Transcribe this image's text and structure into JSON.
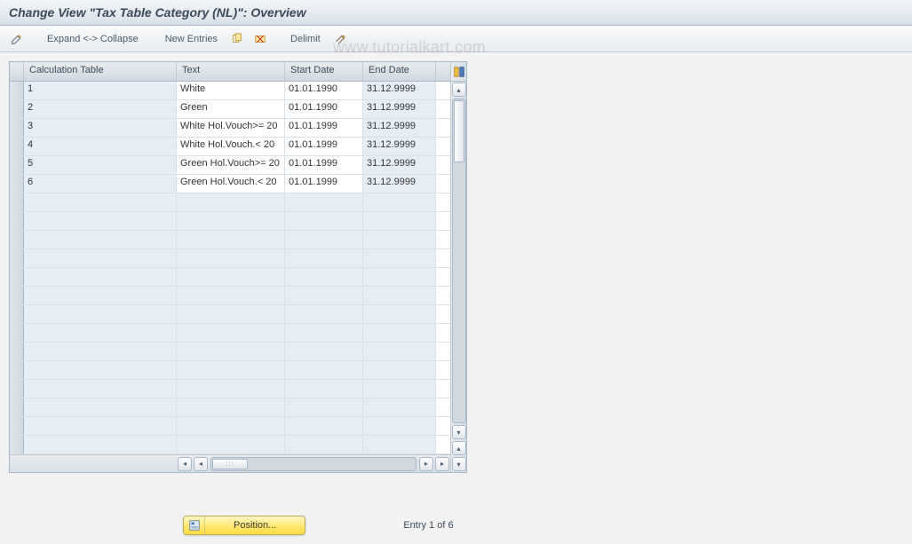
{
  "title": "Change View \"Tax Table Category (NL)\": Overview",
  "toolbar": {
    "change_tooltip": "Change",
    "expand_collapse": "Expand <-> Collapse",
    "new_entries": "New Entries",
    "copy_tooltip": "Copy",
    "delete_tooltip": "Delete",
    "delimit": "Delimit",
    "undo_delimit_tooltip": "Undo"
  },
  "table": {
    "columns": {
      "calc": "Calculation Table",
      "text": "Text",
      "start": "Start Date",
      "end": "End Date"
    },
    "rows": [
      {
        "calc": "1",
        "text": "White",
        "start": "01.01.1990",
        "end": "31.12.9999"
      },
      {
        "calc": "2",
        "text": "Green",
        "start": "01.01.1990",
        "end": "31.12.9999"
      },
      {
        "calc": "3",
        "text": "White Hol.Vouch>= 20",
        "start": "01.01.1999",
        "end": "31.12.9999"
      },
      {
        "calc": "4",
        "text": "White Hol.Vouch.< 20",
        "start": "01.01.1999",
        "end": "31.12.9999"
      },
      {
        "calc": "5",
        "text": "Green Hol.Vouch>= 20",
        "start": "01.01.1999",
        "end": "31.12.9999"
      },
      {
        "calc": "6",
        "text": "Green Hol.Vouch.< 20",
        "start": "01.01.1999",
        "end": "31.12.9999"
      }
    ],
    "empty_row_count": 14
  },
  "footer": {
    "position_label": "Position...",
    "entry_text": "Entry 1 of 6"
  },
  "watermark": "www.tutorialkart.com",
  "icons": {
    "pencil": "pencil-icon",
    "copy": "copy-icon",
    "delete": "delete-icon",
    "undo": "undo-icon",
    "select_all": "select-all-icon",
    "position": "position-icon"
  }
}
